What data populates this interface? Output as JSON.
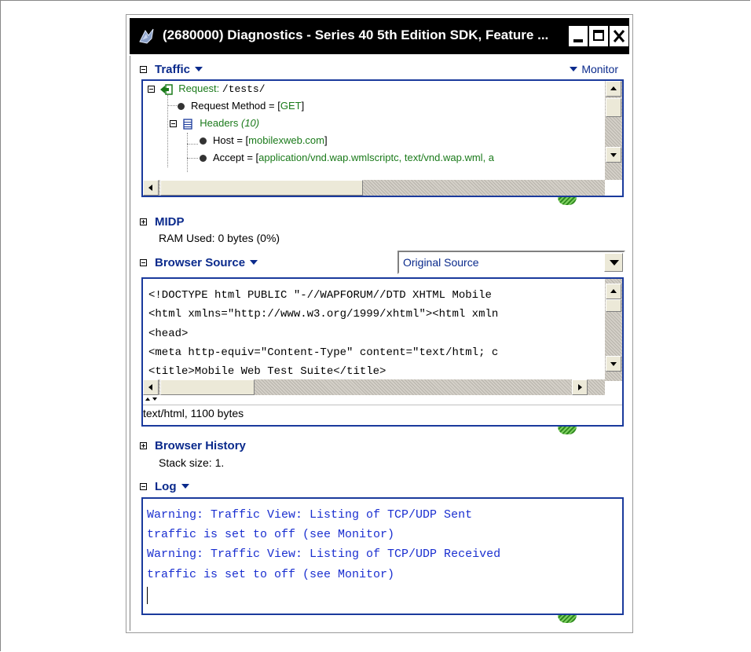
{
  "window": {
    "title": "(2680000) Diagnostics - Series 40 5th Edition SDK, Feature ...",
    "controls": [
      "minimize",
      "maximize",
      "close"
    ]
  },
  "traffic": {
    "title": "Traffic",
    "monitor_label": "Monitor",
    "request_label": "Request: ",
    "request_path": "/tests/",
    "method_label": "Request Method = [",
    "method_value": "GET",
    "method_close": "]",
    "headers_label": "Headers ",
    "headers_count": "(10)",
    "host_label": "Host = [",
    "host_value": "mobilexweb.com",
    "host_close": "]",
    "accept_label": "Accept = [",
    "accept_value": "application/vnd.wap.wmlscriptc, text/vnd.wap.wml, a"
  },
  "midp": {
    "title": "MIDP",
    "ram_used": "RAM Used: 0 bytes (0%)"
  },
  "browser_source": {
    "title": "Browser Source",
    "dropdown_value": "Original Source",
    "lines": [
      "<!DOCTYPE html PUBLIC \"-//WAPFORUM//DTD XHTML Mobile",
      "<html xmlns=\"http://www.w3.org/1999/xhtml\"><html xmln",
      "<head>",
      "<meta http-equiv=\"Content-Type\" content=\"text/html; c",
      "<title>Mobile Web Test Suite</title>"
    ],
    "status": "text/html, 1100 bytes"
  },
  "browser_history": {
    "title": "Browser History",
    "stack_size": "Stack size: 1."
  },
  "log": {
    "title": "Log",
    "lines": [
      "Warning: Traffic View: Listing of TCP/UDP Sent",
      "traffic is set to off (see Monitor)",
      "Warning: Traffic View: Listing of TCP/UDP Received",
      "traffic is set to off (see Monitor)"
    ]
  },
  "colors": {
    "section_title": "#0a2a8c",
    "panel_border": "#1a3a9c",
    "log_text": "#1a2fd0",
    "tree_value": "#1a7a1a"
  }
}
